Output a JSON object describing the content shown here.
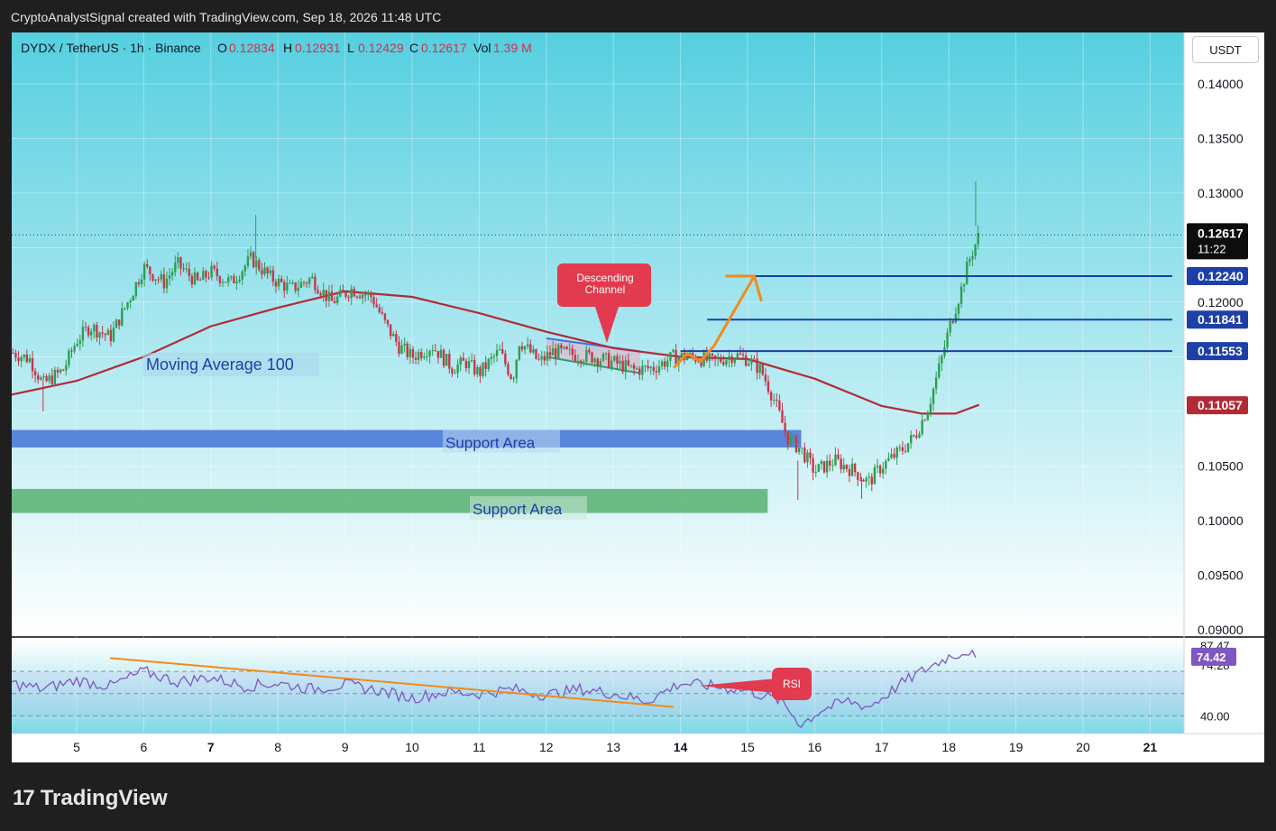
{
  "header": {
    "credit": "CryptoAnalystSignal created with TradingView.com, Sep 18, 2026 11:48 UTC"
  },
  "legend": {
    "symbol": "DYDX / TetherUS · 1h · Binance",
    "open_label": "O",
    "open": "0.12834",
    "high_label": "H",
    "high": "0.12931",
    "low_label": "L",
    "low": "0.12429",
    "close_label": "C",
    "close": "0.12617",
    "vol_label": "Vol",
    "vol": "1.39 M"
  },
  "currency_button": "USDT",
  "price_axis": {
    "ticks": [
      "0.14000",
      "0.13500",
      "0.13000",
      "0.12000",
      "0.10500",
      "0.10000",
      "0.09500",
      "0.09000"
    ],
    "current_price": "0.12617",
    "countdown": "11:22",
    "levels": [
      "0.12240",
      "0.11841",
      "0.11553"
    ],
    "ma_value": "0.11057"
  },
  "time_axis": [
    "5",
    "6",
    "7",
    "8",
    "9",
    "10",
    "11",
    "12",
    "13",
    "14",
    "15",
    "16",
    "17",
    "18",
    "19",
    "20",
    "21"
  ],
  "annotations": {
    "ma_label": "Moving Average 100",
    "support_1": "Support Area",
    "support_2": "Support Area",
    "channel_callout_line1": "Descending",
    "channel_callout_line2": "Channel",
    "rsi_callout": "RSI"
  },
  "rsi_axis": {
    "ticks": [
      "87.47",
      "74.28",
      "40.00"
    ],
    "current": "74.42"
  },
  "colors": {
    "chart_top": "#55cfe0",
    "chart_bottom": "#ffffff",
    "candle_up": "#2e9e4f",
    "candle_down": "#c8354a",
    "ma": "#b22a35",
    "level_line": "#1d3fa8",
    "arrow": "#f28a1a",
    "callout": "#e23a4e",
    "support_blue": "#4d7ad8",
    "support_green": "#58b070"
  },
  "branding": {
    "logo_mark": "17",
    "logo_text": "TradingView"
  },
  "chart_data": {
    "type": "candlestick",
    "symbol": "DYDX / TetherUS",
    "interval": "1h",
    "x_days": [
      5,
      6,
      7,
      8,
      9,
      10,
      11,
      12,
      13,
      14,
      15,
      16,
      17,
      18,
      19,
      20,
      21
    ],
    "ylim": [
      0.09,
      0.1425
    ],
    "close_path": [
      [
        4.0,
        0.1155
      ],
      [
        4.3,
        0.1148
      ],
      [
        4.5,
        0.1125
      ],
      [
        4.8,
        0.1138
      ],
      [
        5.0,
        0.1165
      ],
      [
        5.2,
        0.1178
      ],
      [
        5.5,
        0.1168
      ],
      [
        5.8,
        0.1205
      ],
      [
        6.0,
        0.1232
      ],
      [
        6.3,
        0.1218
      ],
      [
        6.5,
        0.1235
      ],
      [
        6.8,
        0.1218
      ],
      [
        7.0,
        0.1228
      ],
      [
        7.3,
        0.1218
      ],
      [
        7.6,
        0.124
      ],
      [
        7.9,
        0.1222
      ],
      [
        8.2,
        0.1212
      ],
      [
        8.5,
        0.1222
      ],
      [
        8.8,
        0.12
      ],
      [
        9.1,
        0.1212
      ],
      [
        9.4,
        0.1205
      ],
      [
        9.6,
        0.118
      ],
      [
        9.8,
        0.116
      ],
      [
        10.0,
        0.115
      ],
      [
        10.3,
        0.116
      ],
      [
        10.6,
        0.114
      ],
      [
        10.8,
        0.1145
      ],
      [
        11.0,
        0.1135
      ],
      [
        11.3,
        0.1155
      ],
      [
        11.5,
        0.113
      ],
      [
        11.6,
        0.1165
      ],
      [
        11.9,
        0.1145
      ],
      [
        12.1,
        0.1155
      ],
      [
        12.4,
        0.1152
      ],
      [
        12.7,
        0.115
      ],
      [
        13.0,
        0.1145
      ],
      [
        13.3,
        0.1138
      ],
      [
        13.6,
        0.114
      ],
      [
        13.9,
        0.115
      ],
      [
        14.2,
        0.115
      ],
      [
        14.5,
        0.1145
      ],
      [
        14.8,
        0.1152
      ],
      [
        15.0,
        0.1148
      ],
      [
        15.2,
        0.1138
      ],
      [
        15.4,
        0.111
      ],
      [
        15.6,
        0.1075
      ],
      [
        15.8,
        0.1065
      ],
      [
        16.0,
        0.1045
      ],
      [
        16.3,
        0.1055
      ],
      [
        16.6,
        0.1045
      ],
      [
        16.8,
        0.1035
      ],
      [
        17.0,
        0.105
      ],
      [
        17.3,
        0.1065
      ],
      [
        17.5,
        0.1078
      ],
      [
        17.7,
        0.1105
      ],
      [
        17.9,
        0.115
      ],
      [
        18.0,
        0.1175
      ],
      [
        18.1,
        0.1195
      ],
      [
        18.2,
        0.1215
      ],
      [
        18.3,
        0.1238
      ],
      [
        18.45,
        0.1262
      ]
    ],
    "ma100_path": [
      [
        4.0,
        0.1115
      ],
      [
        5.0,
        0.1128
      ],
      [
        6.0,
        0.115
      ],
      [
        7.0,
        0.1178
      ],
      [
        8.0,
        0.1195
      ],
      [
        9.0,
        0.121
      ],
      [
        10.0,
        0.1205
      ],
      [
        11.0,
        0.119
      ],
      [
        12.0,
        0.1173
      ],
      [
        13.0,
        0.1158
      ],
      [
        14.0,
        0.115
      ],
      [
        15.0,
        0.1148
      ],
      [
        16.0,
        0.113
      ],
      [
        17.0,
        0.1105
      ],
      [
        17.6,
        0.1098
      ],
      [
        18.1,
        0.1098
      ],
      [
        18.45,
        0.1106
      ]
    ],
    "levels": [
      {
        "price": 0.1224,
        "x_start": 15.0
      },
      {
        "price": 0.11841,
        "x_start": 14.4
      },
      {
        "price": 0.11553,
        "x_start": 14.0
      }
    ],
    "support_areas": [
      {
        "y_top": 0.1083,
        "y_bottom": 0.1067,
        "x_end": 15.8
      },
      {
        "y_top": 0.1029,
        "y_bottom": 0.1007,
        "x_end": 15.3
      }
    ],
    "channel": {
      "x": [
        12.0,
        13.4
      ],
      "upper": [
        0.1167,
        0.1155
      ],
      "lower": [
        0.115,
        0.1135
      ]
    },
    "arrow": [
      [
        13.9,
        0.114
      ],
      [
        14.1,
        0.1153
      ],
      [
        14.3,
        0.1146
      ],
      [
        14.5,
        0.116
      ],
      [
        15.1,
        0.1224
      ]
    ],
    "rsi": {
      "ylim": [
        28,
        92
      ],
      "levels": [
        70,
        40
      ],
      "path": [
        [
          4.0,
          62
        ],
        [
          4.5,
          58
        ],
        [
          5.0,
          64
        ],
        [
          5.5,
          60
        ],
        [
          6.0,
          70
        ],
        [
          6.5,
          63
        ],
        [
          7.0,
          66
        ],
        [
          7.5,
          60
        ],
        [
          8.0,
          62
        ],
        [
          8.5,
          58
        ],
        [
          9.0,
          61
        ],
        [
          9.5,
          57
        ],
        [
          10.0,
          52
        ],
        [
          10.5,
          56
        ],
        [
          11.0,
          55
        ],
        [
          11.5,
          58
        ],
        [
          12.0,
          54
        ],
        [
          12.5,
          58
        ],
        [
          13.0,
          55
        ],
        [
          13.5,
          50
        ],
        [
          14.0,
          62
        ],
        [
          14.5,
          60
        ],
        [
          15.0,
          57
        ],
        [
          15.5,
          50
        ],
        [
          15.8,
          34
        ],
        [
          16.1,
          44
        ],
        [
          16.5,
          50
        ],
        [
          16.8,
          46
        ],
        [
          17.0,
          52
        ],
        [
          17.3,
          62
        ],
        [
          17.6,
          70
        ],
        [
          18.0,
          80
        ],
        [
          18.3,
          84
        ],
        [
          18.45,
          74.42
        ]
      ],
      "trend_line": [
        [
          5.5,
          79
        ],
        [
          13.9,
          46
        ]
      ]
    }
  }
}
